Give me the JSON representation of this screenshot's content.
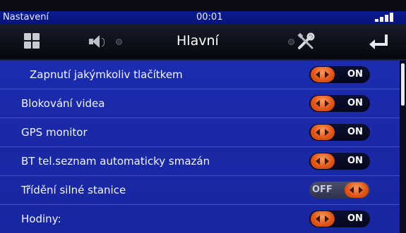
{
  "status": {
    "app_title": "Nastavení",
    "time": "00:01"
  },
  "toolbar": {
    "heading": "Hlavní",
    "icons": [
      "grid-menu-icon",
      "speaker-icon",
      "tools-icon",
      "back-arrow-icon"
    ]
  },
  "settings": [
    {
      "label": "Zapnutí jakýmkoliv tlačítkem",
      "state": "ON"
    },
    {
      "label": "Blokování videa",
      "state": "ON"
    },
    {
      "label": "GPS monitor",
      "state": "ON"
    },
    {
      "label": "BT tel.seznam automaticky smazán",
      "state": "ON"
    },
    {
      "label": "Třídění silné stanice",
      "state": "OFF"
    },
    {
      "label": "Hodiny:",
      "state": "ON"
    }
  ],
  "colors": {
    "accent_blue": "#1b2cb0",
    "status_blue": "#0a1b8f",
    "toggle_knob": "#e2571a"
  }
}
